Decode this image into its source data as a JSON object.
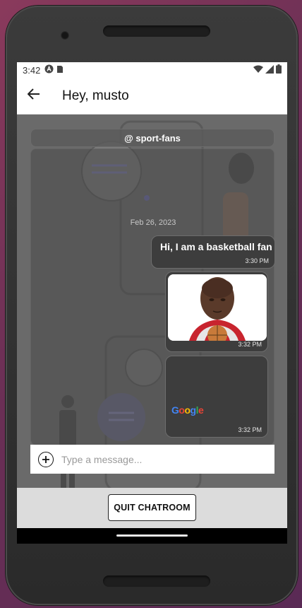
{
  "status_bar": {
    "time": "3:42",
    "left_icons": [
      "app-a-icon",
      "sim-card-icon"
    ],
    "right_icons": [
      "wifi-icon",
      "signal-icon",
      "battery-icon"
    ]
  },
  "app_bar": {
    "back_icon": "arrow-left-icon",
    "title": "Hey, musto"
  },
  "chat": {
    "room_name": "@ sport-fans",
    "date": "Feb 26, 2023",
    "messages": [
      {
        "type": "text",
        "text": "Hi, I am a basketball fan",
        "time": "3:30 PM"
      },
      {
        "type": "image",
        "image": "basketball-player-photo",
        "time": "3:32 PM"
      },
      {
        "type": "image",
        "image": "google-logo-image",
        "logo_text": "Google",
        "time": "3:32 PM"
      }
    ]
  },
  "composer": {
    "add_icon": "plus-circle-icon",
    "placeholder": "Type a message..."
  },
  "footer": {
    "quit_label": "QUIT CHATROOM"
  }
}
